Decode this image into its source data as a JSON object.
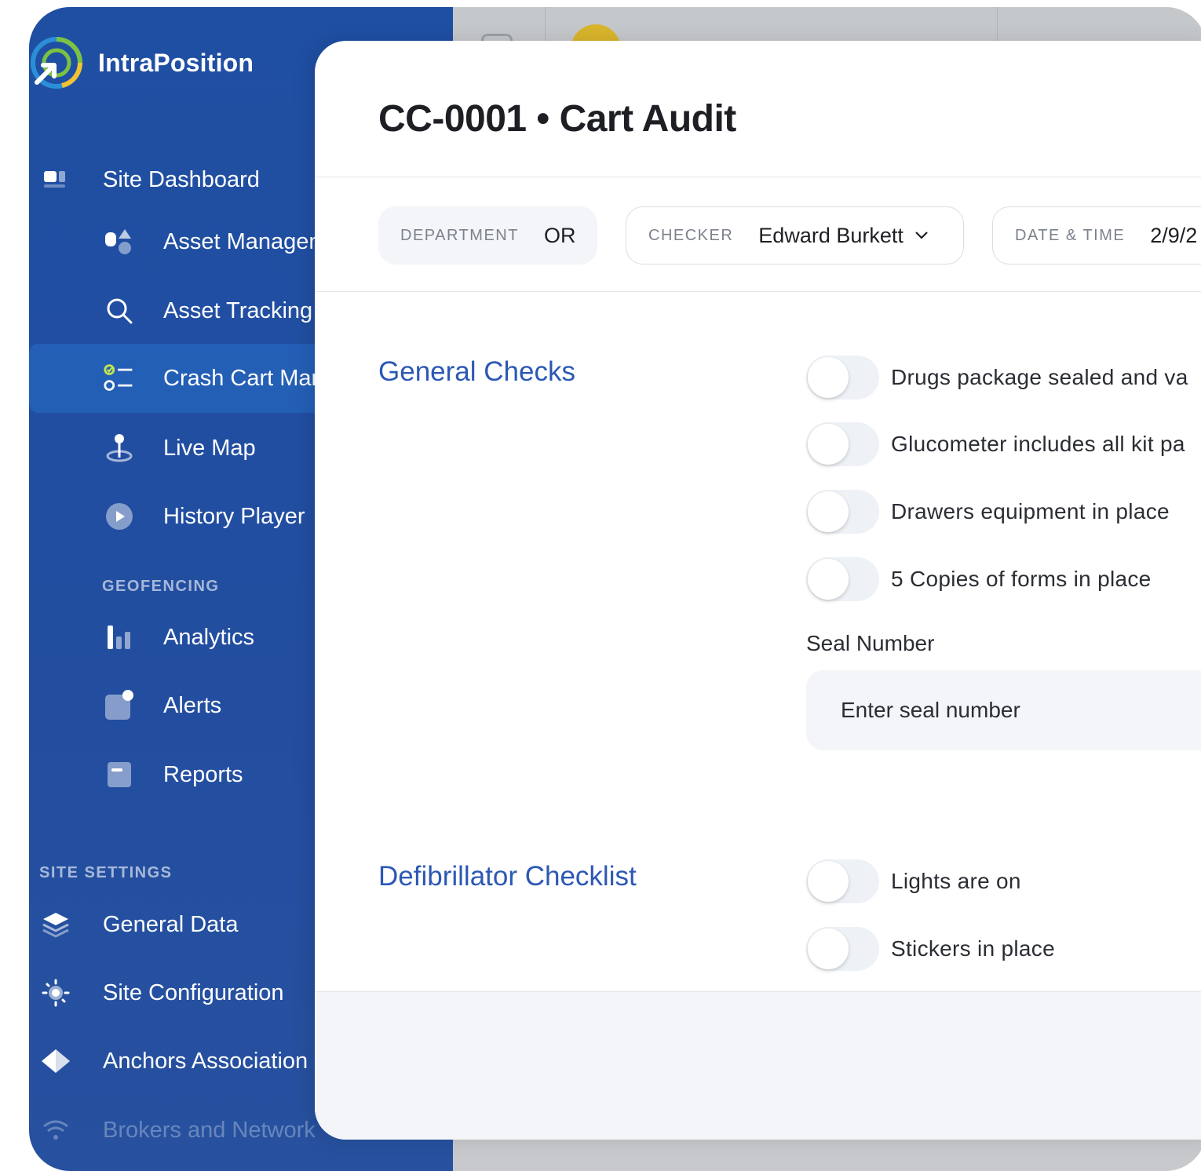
{
  "brand": {
    "name": "IntraPosition"
  },
  "sidebar": {
    "top_item": {
      "label": "Site Dashboard",
      "icon": "dashboard-icon"
    },
    "items": [
      {
        "label": "Asset Management",
        "icon": "shapes-icon"
      },
      {
        "label": "Asset Tracking",
        "icon": "search-icon"
      },
      {
        "label": "Crash Cart Management",
        "icon": "checklist-icon",
        "active": true
      },
      {
        "label": "Live Map",
        "icon": "map-pin-icon"
      },
      {
        "label": "History Player",
        "icon": "play-icon"
      }
    ],
    "geofencing_label": "GEOFENCING",
    "geofencing_items": [
      {
        "label": "Analytics",
        "icon": "bar-chart-icon"
      },
      {
        "label": "Alerts",
        "icon": "alert-bell-icon"
      },
      {
        "label": "Reports",
        "icon": "report-icon"
      }
    ],
    "site_settings_label": "SITE SETTINGS",
    "settings_items": [
      {
        "label": "General Data",
        "icon": "layers-icon"
      },
      {
        "label": "Site Configuration",
        "icon": "gear-icon"
      },
      {
        "label": "Anchors Association",
        "icon": "diamond-icon"
      },
      {
        "label": "Brokers and Network",
        "icon": "wifi-icon"
      }
    ]
  },
  "modal": {
    "title": "CC-0001 • Cart Audit",
    "department": {
      "key": "DEPARTMENT",
      "value": "OR"
    },
    "checker": {
      "key": "CHECKER",
      "value": "Edward Burkett"
    },
    "datetime": {
      "key": "DATE & TIME",
      "value": "2/9/2"
    },
    "general_checks": {
      "title": "General Checks",
      "items": [
        {
          "label": "Drugs package sealed and va",
          "checked": false
        },
        {
          "label": "Glucometer includes all kit pa",
          "checked": false
        },
        {
          "label": "Drawers equipment in place",
          "checked": false
        },
        {
          "label": "5 Copies of forms in place",
          "checked": false
        }
      ],
      "seal_label": "Seal Number",
      "seal_placeholder": "Enter seal number"
    },
    "defib": {
      "title": "Defibrillator Checklist",
      "items": [
        {
          "label": "Lights are on",
          "checked": false
        },
        {
          "label": "Stickers in place",
          "checked": false
        }
      ]
    }
  },
  "colors": {
    "sidebar": "#234ea0",
    "accent": "#2c58b4",
    "avatar": "#d9b52c"
  }
}
